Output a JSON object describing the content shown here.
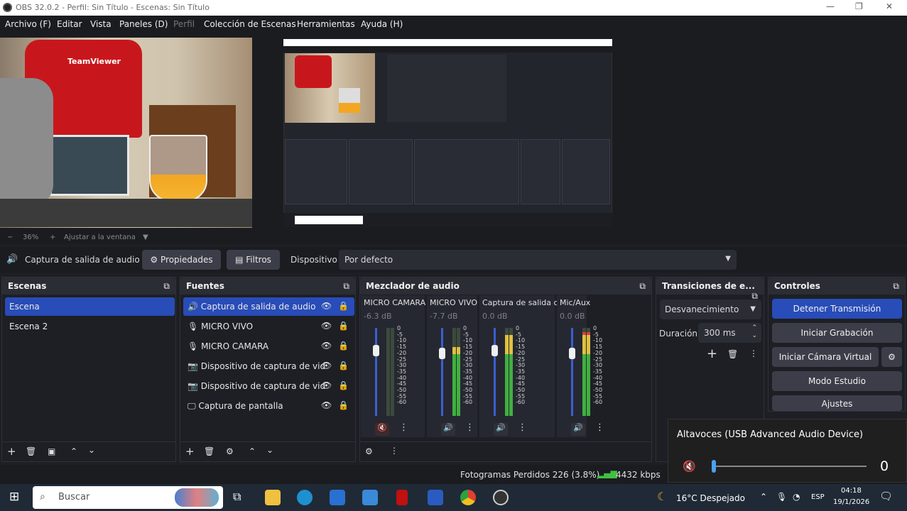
{
  "titlebar": {
    "title": "OBS 32.0.2 - Perfil: Sin Título - Escenas: Sin Título"
  },
  "menu": [
    {
      "label": "Archivo (F)",
      "dim": false
    },
    {
      "label": "Editar",
      "dim": false
    },
    {
      "label": "Vista",
      "dim": false
    },
    {
      "label": "Paneles (D)",
      "dim": false
    },
    {
      "label": "Perfil",
      "dim": true
    },
    {
      "label": "Colección de Escenas",
      "dim": false
    },
    {
      "label": "Herramientas",
      "dim": false
    },
    {
      "label": "Ayuda (H)",
      "dim": false
    }
  ],
  "zoombar": {
    "minus": "−",
    "zoom": "36%",
    "plus": "+",
    "fit": "Ajustar a la ventana"
  },
  "preview": {
    "shirt_text": "TeamViewer"
  },
  "sourcebar": {
    "source_name": "Captura de salida de audio",
    "properties": "Propiedades",
    "filters": "Filtros",
    "device_label": "Dispositivo",
    "device_value": "Por defecto"
  },
  "scenes": {
    "title": "Escenas",
    "items": [
      {
        "label": "Escena",
        "selected": true
      },
      {
        "label": "Escena 2",
        "selected": false
      }
    ]
  },
  "sources": {
    "title": "Fuentes",
    "items": [
      {
        "label": "Captura de salida de audio",
        "icon": "speaker-icon",
        "selected": true
      },
      {
        "label": "MICRO VIVO",
        "icon": "microphone-icon",
        "selected": false
      },
      {
        "label": "MICRO CAMARA",
        "icon": "microphone-icon",
        "selected": false
      },
      {
        "label": "Dispositivo de captura de vid",
        "icon": "camera-icon",
        "selected": false
      },
      {
        "label": "Dispositivo de captura de vid",
        "icon": "camera-icon",
        "selected": false
      },
      {
        "label": "Captura de pantalla",
        "icon": "monitor-icon",
        "selected": false
      }
    ]
  },
  "mixer": {
    "title": "Mezclador de audio",
    "channels": [
      {
        "name": "MICRO CAMARA",
        "db": "-6.3 dB",
        "muted": true,
        "level": 0.0
      },
      {
        "name": "MICRO VIVO",
        "db": "-7.7 dB",
        "muted": false,
        "level": 0.78
      },
      {
        "name": "Captura de salida c",
        "db": "0.0 dB",
        "muted": false,
        "level": 0.92
      },
      {
        "name": "Mic/Aux",
        "db": "0.0 dB",
        "muted": false,
        "level": 0.95
      }
    ],
    "scale": [
      "0",
      "-5",
      "-10",
      "-15",
      "-20",
      "-25",
      "-30",
      "-35",
      "-40",
      "-45",
      "-50",
      "-55",
      "-60"
    ]
  },
  "transitions": {
    "title": "Transiciones de e...",
    "type": "Desvanecimiento",
    "duration_label": "Duración",
    "duration_value": "300 ms"
  },
  "controls": {
    "title": "Controles",
    "buttons": [
      "Detener Transmisión",
      "Iniciar Grabación",
      "Iniciar Cámara Virtual",
      "Modo Estudio",
      "Ajustes"
    ]
  },
  "status": {
    "dropped": "Fotogramas Perdidos 226 (3.8%)",
    "bitrate": "4432 kbps"
  },
  "volume_popup": {
    "device": "Altavoces (USB Advanced Audio Device)",
    "value": "0",
    "level": 0.0
  },
  "taskbar": {
    "search": "Buscar",
    "weather": "16°C  Despejado",
    "lang": "ESP",
    "time": "04:18",
    "date": "19/1/2026"
  },
  "colors": {
    "accent": "#284cb8",
    "panel": "#1e1f25",
    "background": "#1b1c20"
  }
}
